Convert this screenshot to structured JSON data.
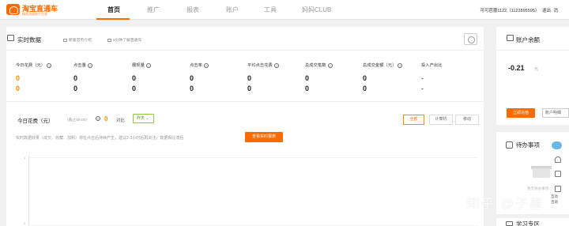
{
  "header": {
    "logo_title": "淘宝直通车",
    "logo_subtitle": "精准流量助力生意",
    "nav": [
      {
        "label": "首页",
        "active": true
      },
      {
        "label": "推广",
        "active": false
      },
      {
        "label": "报表",
        "active": false
      },
      {
        "label": "账户",
        "active": false
      },
      {
        "label": "工具",
        "active": false
      },
      {
        "label": "妈妈CLUB",
        "active": false
      }
    ],
    "account_name": "可可芭蕾1122（1122895595）",
    "logout": "退出",
    "more": "消"
  },
  "realtime": {
    "title": "实时数据",
    "links": [
      "新版首页介绍",
      "5分钟了解直通车"
    ],
    "metrics": [
      {
        "label": "今日花费（元）",
        "today": "0",
        "compare": "0",
        "highlight": true
      },
      {
        "label": "点击量",
        "today": "0",
        "compare": "0"
      },
      {
        "label": "展现量",
        "today": "0",
        "compare": "0"
      },
      {
        "label": "点击率",
        "today": "0",
        "compare": "0"
      },
      {
        "label": "平均点击花费",
        "today": "0",
        "compare": "0"
      },
      {
        "label": "总成交笔数",
        "today": "0",
        "compare": "0"
      },
      {
        "label": "总成交金额（元）",
        "today": "0",
        "compare": "0"
      },
      {
        "label": "投入产出比",
        "today": "-",
        "compare": "-"
      }
    ]
  },
  "trend": {
    "label": "今日花费（元）",
    "time": "（截止18:00）",
    "value": "0",
    "compare_label": "对比",
    "compare_select": "昨天",
    "segments": [
      {
        "label": "全部",
        "active": true
      },
      {
        "label": "计算机",
        "active": false
      },
      {
        "label": "移动",
        "active": false
      }
    ],
    "hint": "实时数据效果（成交、收藏、加购）将在点击后持续产生，建议2-3小时后再关注，数据相比滞后",
    "report_button": "查看实时报表",
    "y_ticks": [
      "1",
      "0"
    ]
  },
  "balance": {
    "title": "账户余额",
    "value": "-0.21",
    "unit": "元",
    "recharge_button": "立即充值",
    "account_button": "账户明细"
  },
  "todo": {
    "title": "待办事项",
    "empty_text": "暂无待办事项"
  },
  "study": {
    "title": "学习专区"
  },
  "float_bar": {
    "items": [
      "互动",
      "咨询"
    ]
  },
  "watermark": "知乎 @子墨",
  "colors": {
    "accent": "#ff6a00",
    "value_orange": "#ff8a00",
    "select_green": "#8cc63f"
  }
}
